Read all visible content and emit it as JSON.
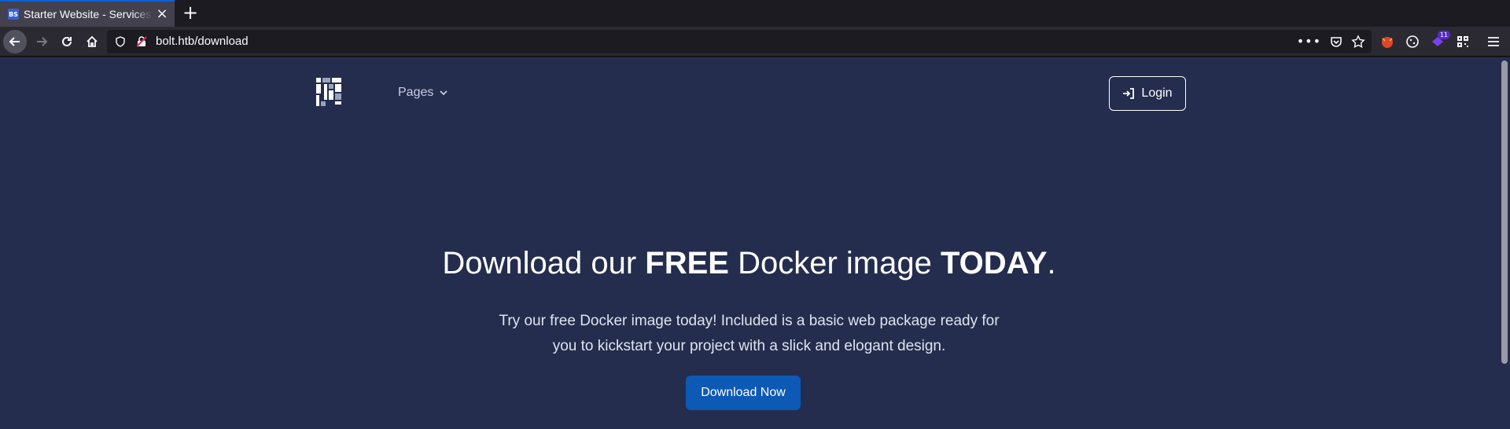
{
  "browser": {
    "tab_title": "Starter Website - Services",
    "tab_favicon_text": "BS",
    "url": "bolt.htb/download",
    "extension_badge": "11"
  },
  "site": {
    "nav_pages_label": "Pages",
    "login_label": "Login",
    "headline": {
      "part1": "Download our ",
      "bold1": "FREE",
      "part2": " Docker image ",
      "bold2": "TODAY",
      "part3": "."
    },
    "subtext_line1": "Try our free Docker image today! Included is a basic web package ready for",
    "subtext_line2": "you to kickstart your project with a slick and elogant design.",
    "download_label": "Download Now"
  },
  "colors": {
    "page_bg": "#242d4d",
    "primary_button": "#0d59b6",
    "browser_chrome": "#2b2a33"
  }
}
